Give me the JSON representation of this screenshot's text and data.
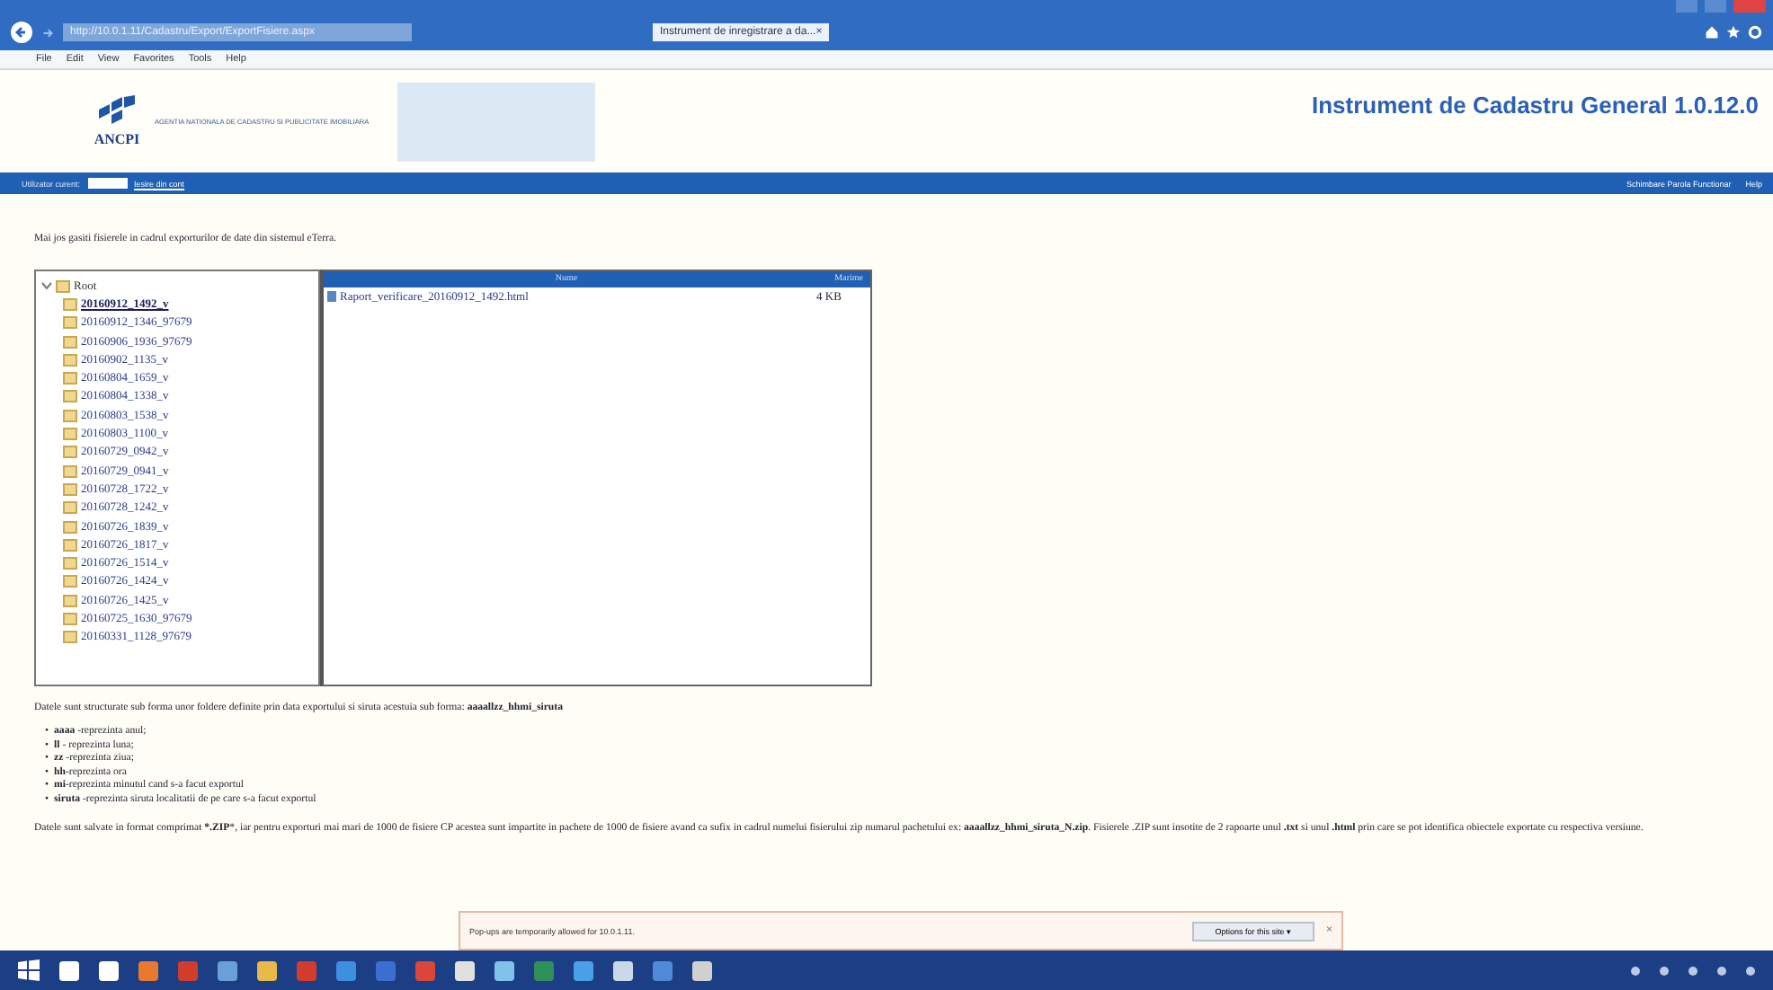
{
  "browser": {
    "address": "http://10.0.1.11/Cadastru/Export/ExportFisiere.aspx",
    "tab_title": "Instrument de inregistrare a da...",
    "tab_close": "×",
    "menu": [
      "File",
      "Edit",
      "View",
      "Favorites",
      "Tools",
      "Help"
    ]
  },
  "header": {
    "logo": "ANCPI",
    "agency": "AGENTIA NATIONALA DE CADASTRU SI PUBLICITATE IMOBILIARA",
    "title": "Instrument de Cadastru General 1.0.12.0"
  },
  "user_bar": {
    "label": "Utilizator curent:",
    "logout": "Iesire din cont",
    "links": [
      "Schimbare Parola Functionar",
      "Help"
    ]
  },
  "intro": "Mai jos gasiti fisierele in cadrul exporturilor de date din sistemul eTerra.",
  "tree": {
    "label": "Root",
    "expanded": true,
    "children": [
      {
        "label": "20160912_1492_v",
        "selected": true
      },
      {
        "label": "20160912_1346_97679",
        "selected": false
      },
      {
        "label": "20160906_1936_97679",
        "selected": false
      },
      {
        "label": "20160902_1135_v",
        "selected": false
      },
      {
        "label": "20160804_1659_v",
        "selected": false
      },
      {
        "label": "20160804_1338_v",
        "selected": false
      },
      {
        "label": "20160803_1538_v",
        "selected": false
      },
      {
        "label": "20160803_1100_v",
        "selected": false
      },
      {
        "label": "20160729_0942_v",
        "selected": false
      },
      {
        "label": "20160729_0941_v",
        "selected": false
      },
      {
        "label": "20160728_1722_v",
        "selected": false
      },
      {
        "label": "20160728_1242_v",
        "selected": false
      },
      {
        "label": "20160726_1839_v",
        "selected": false
      },
      {
        "label": "20160726_1817_v",
        "selected": false
      },
      {
        "label": "20160726_1514_v",
        "selected": false
      },
      {
        "label": "20160726_1424_v",
        "selected": false
      },
      {
        "label": "20160726_1425_v",
        "selected": false
      },
      {
        "label": "20160725_1630_97679",
        "selected": false
      },
      {
        "label": "20160331_1128_97679",
        "selected": false
      }
    ]
  },
  "files": {
    "columns": [
      "Nume",
      "Marime"
    ],
    "rows": [
      {
        "name": "Raport_verificare_20160912_1492.html",
        "size": "4 KB"
      }
    ]
  },
  "structure_text": "Datele sunt structurate sub forma unor foldere definite prin data exportului si siruta acestuia sub forma: **aaaallzz_hhmi_siruta**",
  "legend": [
    {
      "marker": "•",
      "text": "**aaaa** -reprezinta anul;"
    },
    {
      "marker": "•",
      "text": "**ll** - reprezinta luna;"
    },
    {
      "marker": "•",
      "text": "**zz** -reprezinta ziua;"
    },
    {
      "marker": "•",
      "text": "**hh**-reprezinta ora"
    },
    {
      "marker": "•",
      "text": "**mi**-reprezinta minutul cand s-a facut exportul"
    },
    {
      "marker": "•",
      "text": "**siruta** -reprezinta siruta localitatii de pe care s-a facut exportul"
    }
  ],
  "zip_text": "Datele sunt salvate in format comprimat ***.ZIP***, iar pentru exporturi mai mari de 1000 de fisiere CP acestea sunt impartite in pachete de 1000 de fisiere avand ca sufix in cadrul numelui fisierului zip numarul pachetului ex: **aaaallzz_hhmi_siruta_N.zip**. Fisierele .ZIP sunt insotite de 2 rapoarte unul **.txt** si unul **.html** prin care se pot identifica obiectele exportate cu respectiva versiune.",
  "popup": {
    "message": "Pop-ups are temporarily allowed for 10.0.1.11.",
    "button": "Options for this site ▾",
    "close": "×"
  }
}
